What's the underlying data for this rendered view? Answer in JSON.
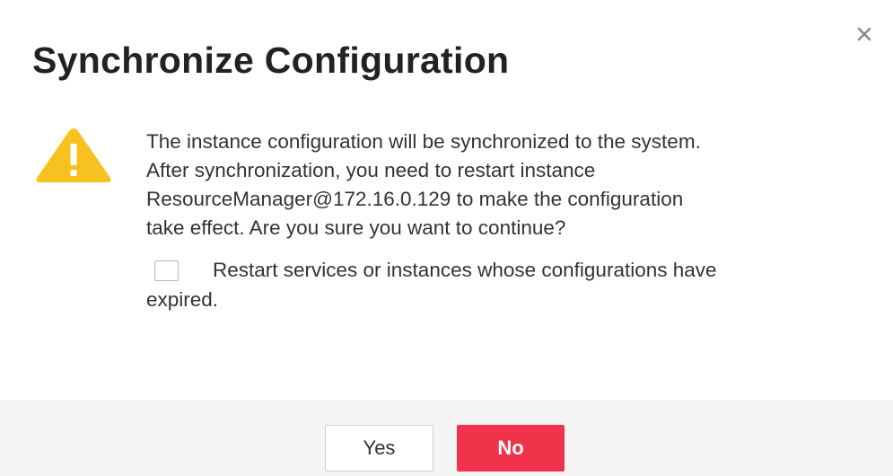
{
  "dialog": {
    "title": "Synchronize Configuration",
    "close_icon": "close-icon",
    "warning_icon": "warning-triangle-icon",
    "message_lines": [
      "The instance configuration will be synchronized to the system.",
      "After synchronization, you need to restart instance",
      "ResourceManager@172.16.0.129 to make the configuration",
      "take effect. Are you sure you want to continue?"
    ],
    "option": {
      "checked": false,
      "label_line1": "Restart services or instances whose configurations have",
      "label_line2": "expired."
    }
  },
  "footer": {
    "yes_label": "Yes",
    "no_label": "No"
  },
  "colors": {
    "primary_button": "#f0324b",
    "warning": "#f7c21f",
    "footer_bg": "#f5f5f5"
  }
}
